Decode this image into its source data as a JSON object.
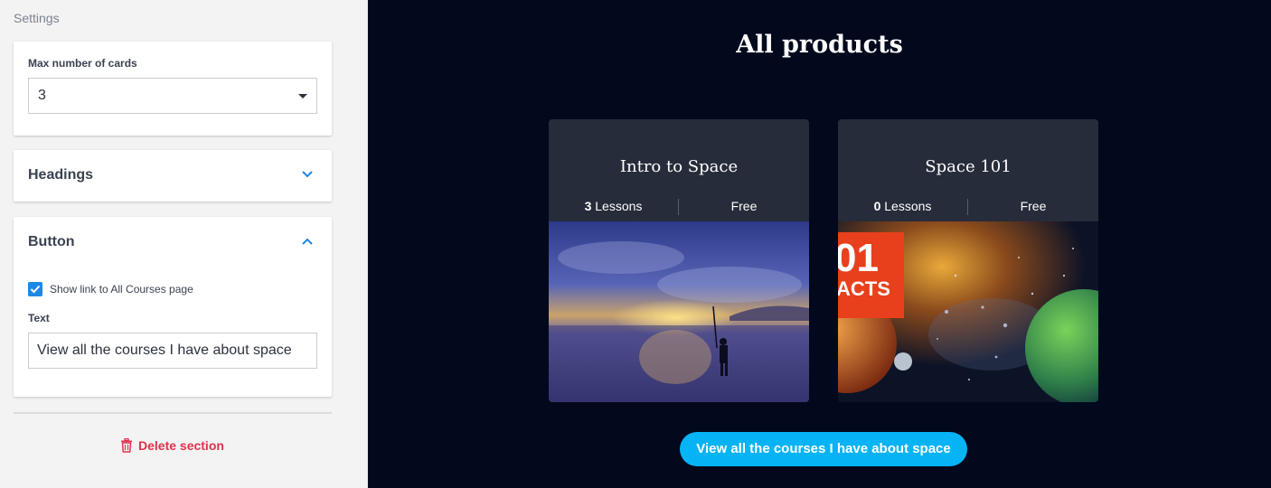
{
  "settings": {
    "title": "Settings",
    "max_cards": {
      "label": "Max number of cards",
      "value": "3"
    },
    "headings": {
      "label": "Headings"
    },
    "button": {
      "label": "Button",
      "show_link_label": "Show link to All Courses page",
      "text_label": "Text",
      "text_value": "View all the courses I have about space"
    },
    "delete_label": "Delete section"
  },
  "preview": {
    "title": "All products",
    "products": [
      {
        "title": "Intro to Space",
        "lessons_count": "3",
        "lessons_word": " Lessons",
        "price": "Free"
      },
      {
        "title": "Space 101",
        "lessons_count": "0",
        "lessons_word": " Lessons",
        "price": "Free",
        "image_text_1": "01",
        "image_text_2": "ACTS"
      }
    ],
    "cta_label": "View all the courses I have about space"
  },
  "colors": {
    "accent": "#06b3f4",
    "danger": "#e0324b",
    "preview_bg": "#02091c",
    "card_bg": "#262c3a"
  },
  "icons": [
    "chevron-down-icon",
    "chevron-up-icon",
    "checkbox-checked-icon",
    "trash-icon",
    "caret-down-icon"
  ]
}
